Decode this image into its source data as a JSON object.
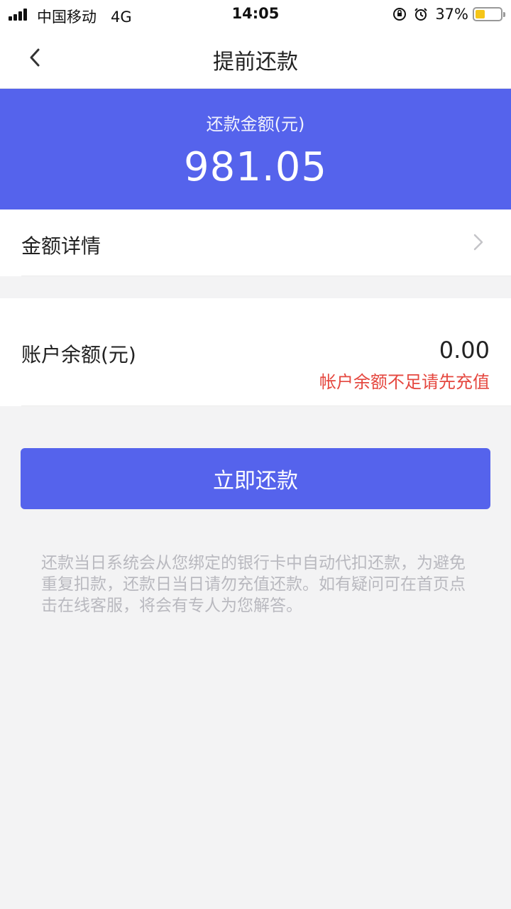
{
  "status_bar": {
    "carrier": "中国移动",
    "network": "4G",
    "time": "14:05",
    "battery_percent": "37%",
    "battery_level": 0.37,
    "icons": [
      "signal-icon",
      "orientation-lock-icon",
      "alarm-icon",
      "battery-icon"
    ]
  },
  "navbar": {
    "title": "提前还款",
    "back_icon": "chevron-left-icon"
  },
  "hero": {
    "label": "还款金额(元)",
    "amount": "981.05"
  },
  "detail_row": {
    "label": "金额详情",
    "icon": "chevron-right-icon"
  },
  "balance": {
    "label": "账户余额(元)",
    "value": "0.00",
    "warning": "帐户余额不足请先充值"
  },
  "action": {
    "button_label": "立即还款"
  },
  "notice": {
    "text": "还款当日系统会从您绑定的银行卡中自动代扣还款，为避免重复扣款，还款日当日请勿充值还款。如有疑问可在首页点击在线客服，将会有专人为您解答。"
  },
  "colors": {
    "accent": "#5563ec",
    "warning": "#e5473f",
    "background": "#f3f3f4",
    "battery": "#f5c518"
  }
}
